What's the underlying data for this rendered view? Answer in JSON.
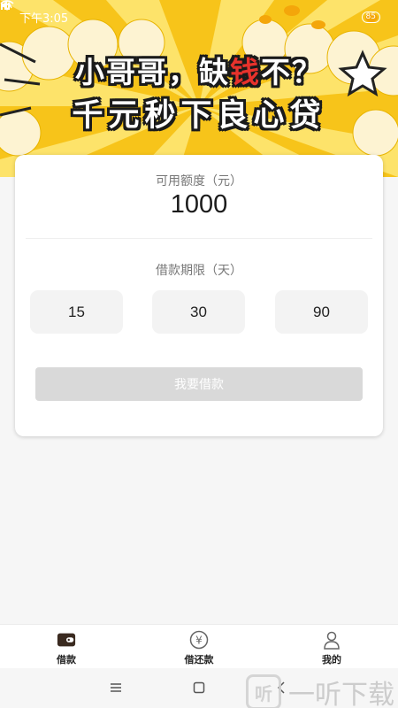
{
  "status": {
    "time": "下午3:05",
    "battery": "85"
  },
  "banner": {
    "line1_a": "小哥哥，缺",
    "line1_red": "钱",
    "line1_b": "不？",
    "line2": "千元秒下良心贷"
  },
  "credit": {
    "label": "可用额度（元）",
    "amount": "1000"
  },
  "period": {
    "label": "借款期限（天）",
    "options": [
      "15",
      "30",
      "90"
    ]
  },
  "apply_button": {
    "label": "我要借款",
    "state": "disabled"
  },
  "tabs": [
    {
      "label": "借款",
      "icon": "wallet-icon",
      "active": true
    },
    {
      "label": "借还款",
      "icon": "yen-coin-icon",
      "active": false
    },
    {
      "label": "我的",
      "icon": "person-icon",
      "active": false
    }
  ],
  "watermark": {
    "text": "一听下载",
    "logo_glyph": "听"
  },
  "colors": {
    "banner": "#f7c41a",
    "slogan_red": "#e8322c",
    "button_disabled": "#d9d9d9"
  }
}
